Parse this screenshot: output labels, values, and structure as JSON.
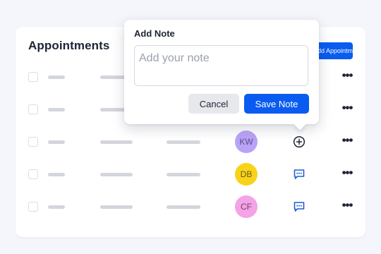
{
  "appointments": {
    "title": "Appointments",
    "add_button_label": "Add Appointment",
    "rows": [
      {
        "avatar_initials": "",
        "avatar_color": "",
        "action_icon": ""
      },
      {
        "avatar_initials": "",
        "avatar_color": "",
        "action_icon": ""
      },
      {
        "avatar_initials": "KW",
        "avatar_color": "#b9a3f6",
        "action_icon": "plus-circle-icon"
      },
      {
        "avatar_initials": "DB",
        "avatar_color": "#f7d419",
        "action_icon": "message-icon"
      },
      {
        "avatar_initials": "CF",
        "avatar_color": "#f3a3e6",
        "action_icon": "message-icon"
      }
    ],
    "more_label": "•••"
  },
  "note_popover": {
    "title": "Add Note",
    "input_value": "",
    "input_placeholder": "Add your note",
    "cancel_label": "Cancel",
    "save_label": "Save Note"
  },
  "colors": {
    "primary": "#0a5cf0",
    "placeholder_bar": "#d3d6dc",
    "icon_blue": "#1f5fd1"
  }
}
